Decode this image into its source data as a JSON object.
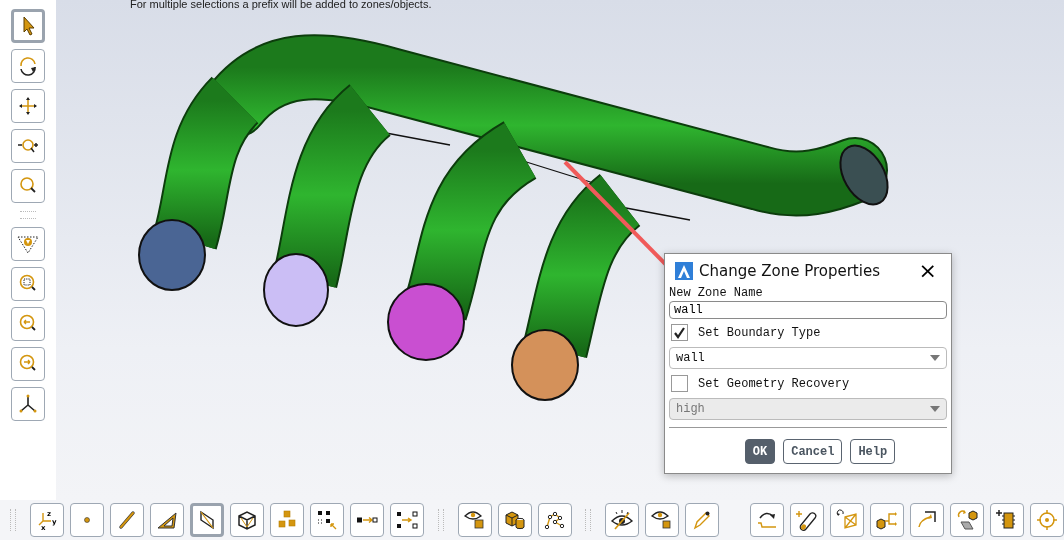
{
  "viewport": {
    "hint": "For multiple selections a prefix will be added to zones/objects."
  },
  "left_toolbar": {
    "tools": [
      {
        "kind": "select",
        "selected": true
      },
      {
        "kind": "rotate",
        "selected": false
      },
      {
        "kind": "pan",
        "selected": false
      },
      {
        "kind": "zoom-in-out",
        "selected": false
      },
      {
        "kind": "zoom",
        "selected": false
      },
      {
        "kind": "fit-triangle",
        "selected": false
      },
      {
        "kind": "zoom-box",
        "selected": false
      },
      {
        "kind": "zoom-back",
        "selected": false
      },
      {
        "kind": "zoom-forward",
        "selected": false
      },
      {
        "kind": "axes",
        "selected": false
      }
    ]
  },
  "bottom_toolbar": {
    "groups": [
      {
        "tools": [
          {
            "kind": "xyz",
            "selected": false,
            "labels": [
              "z",
              "y",
              "x"
            ]
          },
          {
            "kind": "point",
            "selected": false
          },
          {
            "kind": "line",
            "selected": false
          },
          {
            "kind": "triangle",
            "selected": false
          },
          {
            "kind": "quad",
            "selected": true
          },
          {
            "kind": "cube",
            "selected": false
          },
          {
            "kind": "cubes",
            "selected": false
          },
          {
            "kind": "grid-select",
            "selected": false
          },
          {
            "kind": "move-arrow",
            "selected": false
          },
          {
            "kind": "split-arrow",
            "selected": false
          }
        ]
      },
      {
        "tools": [
          {
            "kind": "eye-box",
            "selected": false
          },
          {
            "kind": "cube-cylinder",
            "selected": false
          },
          {
            "kind": "polyline",
            "selected": false
          }
        ]
      },
      {
        "tools": [
          {
            "kind": "eye-hidden",
            "selected": false
          },
          {
            "kind": "eye-square",
            "selected": false
          },
          {
            "kind": "pencil",
            "selected": false
          }
        ]
      },
      {
        "tools": [
          {
            "kind": "curve-arrow",
            "selected": false
          },
          {
            "kind": "cylinder-plus",
            "selected": false
          },
          {
            "kind": "rotate-plane",
            "selected": false
          },
          {
            "kind": "cube-branch",
            "selected": false
          },
          {
            "kind": "corner-arrow",
            "selected": false
          },
          {
            "kind": "rotate-plate",
            "selected": false
          },
          {
            "kind": "chip-plus",
            "selected": false
          },
          {
            "kind": "crosshair",
            "selected": false
          }
        ]
      }
    ]
  },
  "dialog": {
    "title": "Change Zone Properties",
    "close": "×",
    "name_label": "New Zone Name",
    "name_value": "wall",
    "boundary": {
      "label": "Set Boundary Type",
      "checked": true,
      "value": "wall",
      "disabled": false
    },
    "recovery": {
      "label": "Set Geometry Recovery",
      "checked": false,
      "value": "high",
      "disabled": true
    },
    "buttons": [
      {
        "label": "OK",
        "default": true
      },
      {
        "label": "Cancel",
        "default": false
      },
      {
        "label": "Help",
        "default": false
      }
    ]
  }
}
